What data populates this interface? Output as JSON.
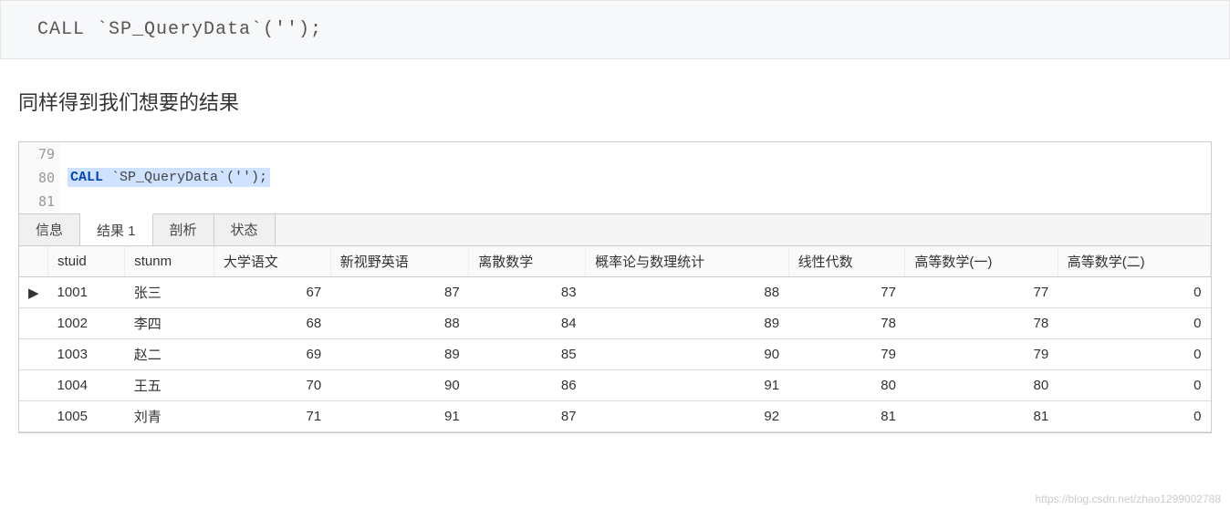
{
  "top_code": "CALL `SP_QueryData`('');",
  "description": "同样得到我们想要的结果",
  "editor": {
    "lines": [
      {
        "num": "79",
        "code": ""
      },
      {
        "num": "80",
        "code_call": "CALL",
        "code_rest": " `SP_QueryData`('');"
      },
      {
        "num": "81",
        "code": ""
      }
    ]
  },
  "tabs": {
    "info": "信息",
    "result": "结果 1",
    "profile": "剖析",
    "status": "状态"
  },
  "table": {
    "headers": {
      "indicator": "",
      "stuid": "stuid",
      "stunm": "stunm",
      "c1": "大学语文",
      "c2": "新视野英语",
      "c3": "离散数学",
      "c4": "概率论与数理统计",
      "c5": "线性代数",
      "c6": "高等数学(一)",
      "c7": "高等数学(二)"
    },
    "rows": [
      {
        "current": true,
        "stuid": "1001",
        "stunm": "张三",
        "v": [
          "67",
          "87",
          "83",
          "88",
          "77",
          "77",
          "0"
        ]
      },
      {
        "current": false,
        "stuid": "1002",
        "stunm": "李四",
        "v": [
          "68",
          "88",
          "84",
          "89",
          "78",
          "78",
          "0"
        ]
      },
      {
        "current": false,
        "stuid": "1003",
        "stunm": "赵二",
        "v": [
          "69",
          "89",
          "85",
          "90",
          "79",
          "79",
          "0"
        ]
      },
      {
        "current": false,
        "stuid": "1004",
        "stunm": "王五",
        "v": [
          "70",
          "90",
          "86",
          "91",
          "80",
          "80",
          "0"
        ]
      },
      {
        "current": false,
        "stuid": "1005",
        "stunm": "刘青",
        "v": [
          "71",
          "91",
          "87",
          "92",
          "81",
          "81",
          "0"
        ]
      }
    ]
  },
  "watermark": "https://blog.csdn.net/zhao1299002788"
}
